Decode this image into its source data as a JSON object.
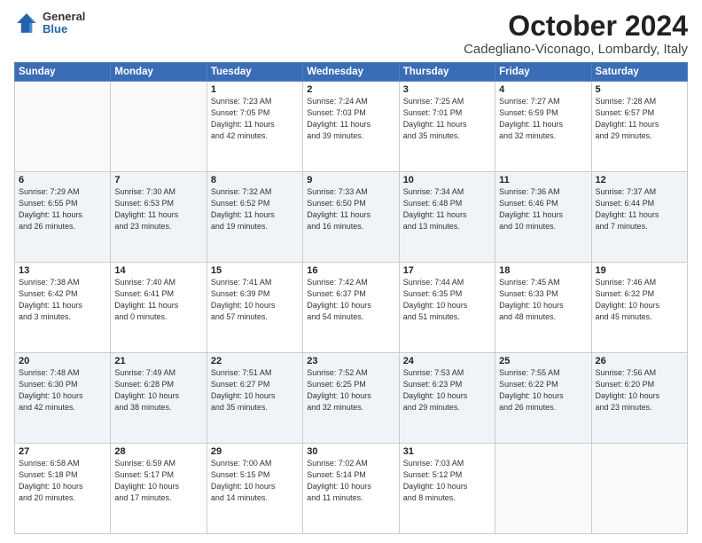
{
  "logo": {
    "general": "General",
    "blue": "Blue"
  },
  "header": {
    "month": "October 2024",
    "location": "Cadegliano-Viconago, Lombardy, Italy"
  },
  "weekdays": [
    "Sunday",
    "Monday",
    "Tuesday",
    "Wednesday",
    "Thursday",
    "Friday",
    "Saturday"
  ],
  "weeks": [
    [
      {
        "day": "",
        "info": ""
      },
      {
        "day": "",
        "info": ""
      },
      {
        "day": "1",
        "info": "Sunrise: 7:23 AM\nSunset: 7:05 PM\nDaylight: 11 hours\nand 42 minutes."
      },
      {
        "day": "2",
        "info": "Sunrise: 7:24 AM\nSunset: 7:03 PM\nDaylight: 11 hours\nand 39 minutes."
      },
      {
        "day": "3",
        "info": "Sunrise: 7:25 AM\nSunset: 7:01 PM\nDaylight: 11 hours\nand 35 minutes."
      },
      {
        "day": "4",
        "info": "Sunrise: 7:27 AM\nSunset: 6:59 PM\nDaylight: 11 hours\nand 32 minutes."
      },
      {
        "day": "5",
        "info": "Sunrise: 7:28 AM\nSunset: 6:57 PM\nDaylight: 11 hours\nand 29 minutes."
      }
    ],
    [
      {
        "day": "6",
        "info": "Sunrise: 7:29 AM\nSunset: 6:55 PM\nDaylight: 11 hours\nand 26 minutes."
      },
      {
        "day": "7",
        "info": "Sunrise: 7:30 AM\nSunset: 6:53 PM\nDaylight: 11 hours\nand 23 minutes."
      },
      {
        "day": "8",
        "info": "Sunrise: 7:32 AM\nSunset: 6:52 PM\nDaylight: 11 hours\nand 19 minutes."
      },
      {
        "day": "9",
        "info": "Sunrise: 7:33 AM\nSunset: 6:50 PM\nDaylight: 11 hours\nand 16 minutes."
      },
      {
        "day": "10",
        "info": "Sunrise: 7:34 AM\nSunset: 6:48 PM\nDaylight: 11 hours\nand 13 minutes."
      },
      {
        "day": "11",
        "info": "Sunrise: 7:36 AM\nSunset: 6:46 PM\nDaylight: 11 hours\nand 10 minutes."
      },
      {
        "day": "12",
        "info": "Sunrise: 7:37 AM\nSunset: 6:44 PM\nDaylight: 11 hours\nand 7 minutes."
      }
    ],
    [
      {
        "day": "13",
        "info": "Sunrise: 7:38 AM\nSunset: 6:42 PM\nDaylight: 11 hours\nand 3 minutes."
      },
      {
        "day": "14",
        "info": "Sunrise: 7:40 AM\nSunset: 6:41 PM\nDaylight: 11 hours\nand 0 minutes."
      },
      {
        "day": "15",
        "info": "Sunrise: 7:41 AM\nSunset: 6:39 PM\nDaylight: 10 hours\nand 57 minutes."
      },
      {
        "day": "16",
        "info": "Sunrise: 7:42 AM\nSunset: 6:37 PM\nDaylight: 10 hours\nand 54 minutes."
      },
      {
        "day": "17",
        "info": "Sunrise: 7:44 AM\nSunset: 6:35 PM\nDaylight: 10 hours\nand 51 minutes."
      },
      {
        "day": "18",
        "info": "Sunrise: 7:45 AM\nSunset: 6:33 PM\nDaylight: 10 hours\nand 48 minutes."
      },
      {
        "day": "19",
        "info": "Sunrise: 7:46 AM\nSunset: 6:32 PM\nDaylight: 10 hours\nand 45 minutes."
      }
    ],
    [
      {
        "day": "20",
        "info": "Sunrise: 7:48 AM\nSunset: 6:30 PM\nDaylight: 10 hours\nand 42 minutes."
      },
      {
        "day": "21",
        "info": "Sunrise: 7:49 AM\nSunset: 6:28 PM\nDaylight: 10 hours\nand 38 minutes."
      },
      {
        "day": "22",
        "info": "Sunrise: 7:51 AM\nSunset: 6:27 PM\nDaylight: 10 hours\nand 35 minutes."
      },
      {
        "day": "23",
        "info": "Sunrise: 7:52 AM\nSunset: 6:25 PM\nDaylight: 10 hours\nand 32 minutes."
      },
      {
        "day": "24",
        "info": "Sunrise: 7:53 AM\nSunset: 6:23 PM\nDaylight: 10 hours\nand 29 minutes."
      },
      {
        "day": "25",
        "info": "Sunrise: 7:55 AM\nSunset: 6:22 PM\nDaylight: 10 hours\nand 26 minutes."
      },
      {
        "day": "26",
        "info": "Sunrise: 7:56 AM\nSunset: 6:20 PM\nDaylight: 10 hours\nand 23 minutes."
      }
    ],
    [
      {
        "day": "27",
        "info": "Sunrise: 6:58 AM\nSunset: 5:18 PM\nDaylight: 10 hours\nand 20 minutes."
      },
      {
        "day": "28",
        "info": "Sunrise: 6:59 AM\nSunset: 5:17 PM\nDaylight: 10 hours\nand 17 minutes."
      },
      {
        "day": "29",
        "info": "Sunrise: 7:00 AM\nSunset: 5:15 PM\nDaylight: 10 hours\nand 14 minutes."
      },
      {
        "day": "30",
        "info": "Sunrise: 7:02 AM\nSunset: 5:14 PM\nDaylight: 10 hours\nand 11 minutes."
      },
      {
        "day": "31",
        "info": "Sunrise: 7:03 AM\nSunset: 5:12 PM\nDaylight: 10 hours\nand 8 minutes."
      },
      {
        "day": "",
        "info": ""
      },
      {
        "day": "",
        "info": ""
      }
    ]
  ]
}
